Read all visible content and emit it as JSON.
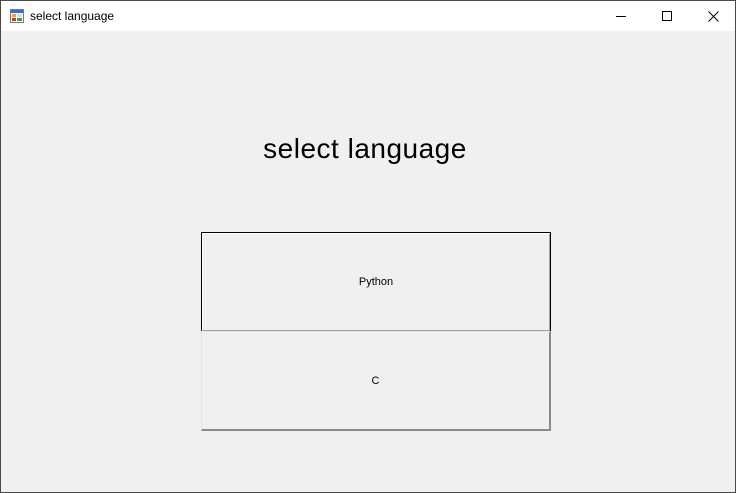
{
  "window": {
    "title": "select language",
    "icon": "winforms-app-icon",
    "controls": {
      "minimize_icon": "minimize-icon",
      "maximize_icon": "maximize-icon",
      "close_icon": "close-icon"
    }
  },
  "main": {
    "heading": "select language",
    "buttons": [
      {
        "label": "Python"
      },
      {
        "label": "C"
      }
    ]
  },
  "colors": {
    "background": "#f0f0f0",
    "titlebar": "#ffffff",
    "text": "#000000"
  }
}
